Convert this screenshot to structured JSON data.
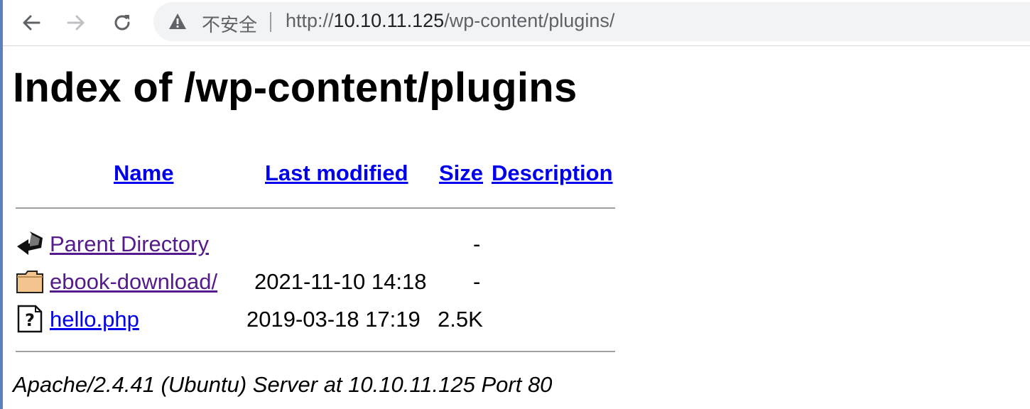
{
  "browser": {
    "security_label": "不安全",
    "url_scheme": "http://",
    "url_host": "10.10.11.125",
    "url_path": "/wp-content/plugins/"
  },
  "page": {
    "title": "Index of /wp-content/plugins",
    "columns": {
      "name": "Name",
      "last_modified": "Last modified",
      "size": "Size",
      "description": "Description"
    },
    "rows": [
      {
        "icon": "back-icon",
        "name": "Parent Directory",
        "modified": "",
        "size": "-"
      },
      {
        "icon": "folder-icon",
        "name": "ebook-download/",
        "modified": "2021-11-10 14:18",
        "size": "-"
      },
      {
        "icon": "unknown-file-icon",
        "name": "hello.php",
        "modified": "2019-03-18 17:19",
        "size": "2.5K"
      }
    ],
    "footer": "Apache/2.4.41 (Ubuntu) Server at 10.10.11.125 Port 80"
  },
  "colors": {
    "link": "#0000ee",
    "visited_link": "#551a8b",
    "omnibox_bg": "#f1f3f4"
  }
}
